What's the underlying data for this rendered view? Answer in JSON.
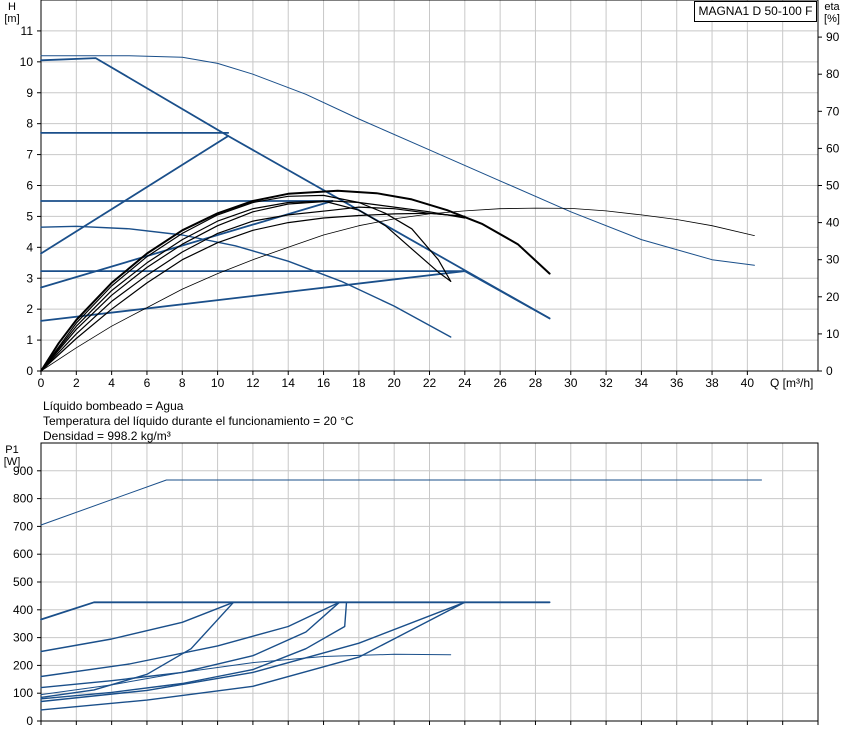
{
  "title": "MAGNA1 D 50-100 F",
  "fluid_info": [
    "Líquido bombeado = Agua",
    "Temperatura del líquido durante el funcionamiento = 20 °C",
    "Densidad = 998.2 kg/m³"
  ],
  "colors": {
    "blue": "#1a4f8a",
    "black": "#000000",
    "grid": "#c8c8c8"
  },
  "chart_data": [
    {
      "type": "line",
      "name": "top",
      "ylabel": "H",
      "yunit": "[m]",
      "y2label": "eta",
      "y2unit": "[%]",
      "xlabel": "Q [m³/h]",
      "xlim": [
        0,
        44
      ],
      "ylim": [
        0,
        12
      ],
      "y2lim": [
        0,
        100
      ],
      "xticks": [
        "0",
        "2",
        "4",
        "6",
        "8",
        "10",
        "12",
        "14",
        "16",
        "18",
        "20",
        "22",
        "24",
        "26",
        "28",
        "30",
        "32",
        "34",
        "36",
        "38",
        "40"
      ],
      "yticks": [
        "0",
        "1",
        "2",
        "3",
        "4",
        "5",
        "6",
        "7",
        "8",
        "9",
        "10",
        "11"
      ],
      "y2ticks": [
        "0",
        "10",
        "20",
        "30",
        "40",
        "50",
        "60",
        "70",
        "80",
        "90"
      ],
      "grid": true,
      "series": [
        {
          "color": "blue",
          "width": 1.8,
          "points": [
            [
              0,
              10.05
            ],
            [
              3.1,
              10.12
            ],
            [
              10.6,
              7.6
            ],
            [
              28.8,
              1.7
            ]
          ]
        },
        {
          "color": "blue",
          "width": 1.8,
          "points": [
            [
              0,
              7.7
            ],
            [
              10.6,
              7.7
            ]
          ]
        },
        {
          "color": "blue",
          "width": 1.8,
          "points": [
            [
              0,
              3.8
            ],
            [
              10.6,
              7.6
            ]
          ]
        },
        {
          "color": "blue",
          "width": 1.8,
          "points": [
            [
              0,
              5.5
            ],
            [
              16.5,
              5.5
            ]
          ]
        },
        {
          "color": "blue",
          "width": 1.8,
          "points": [
            [
              0,
              2.7
            ],
            [
              16.5,
              5.5
            ]
          ]
        },
        {
          "color": "blue",
          "width": 1.8,
          "points": [
            [
              0,
              3.23
            ],
            [
              24,
              3.23
            ],
            [
              28.8,
              1.7
            ]
          ]
        },
        {
          "color": "blue",
          "width": 1.8,
          "points": [
            [
              0,
              1.62
            ],
            [
              24,
              3.23
            ]
          ]
        },
        {
          "color": "blue",
          "width": 1.4,
          "points": [
            [
              0,
              4.65
            ],
            [
              2,
              4.68
            ],
            [
              5,
              4.6
            ],
            [
              8,
              4.4
            ],
            [
              11,
              4.05
            ],
            [
              14,
              3.55
            ],
            [
              17,
              2.9
            ],
            [
              20,
              2.1
            ],
            [
              23.2,
              1.1
            ]
          ]
        },
        {
          "color": "blue",
          "width": 1.0,
          "points": [
            [
              0,
              10.2
            ],
            [
              5,
              10.2
            ],
            [
              8,
              10.15
            ],
            [
              10,
              9.95
            ],
            [
              12,
              9.6
            ],
            [
              15,
              8.95
            ],
            [
              18,
              8.15
            ],
            [
              22,
              7.15
            ],
            [
              26,
              6.15
            ],
            [
              30,
              5.15
            ],
            [
              34,
              4.25
            ],
            [
              38,
              3.6
            ],
            [
              40.4,
              3.42
            ]
          ]
        },
        {
          "color": "black",
          "width": 2.0,
          "points": [
            [
              0,
              0
            ],
            [
              1,
              0.9
            ],
            [
              2,
              1.65
            ],
            [
              4,
              2.85
            ],
            [
              6,
              3.8
            ],
            [
              8,
              4.55
            ],
            [
              10,
              5.1
            ],
            [
              12,
              5.5
            ],
            [
              14,
              5.73
            ],
            [
              16.8,
              5.83
            ],
            [
              19,
              5.75
            ],
            [
              21,
              5.55
            ],
            [
              23,
              5.2
            ],
            [
              25,
              4.75
            ],
            [
              27,
              4.1
            ],
            [
              28.8,
              3.15
            ]
          ]
        },
        {
          "color": "black",
          "width": 1.2,
          "points": [
            [
              0,
              0
            ],
            [
              2,
              1.55
            ],
            [
              4,
              2.75
            ],
            [
              6,
              3.7
            ],
            [
              8,
              4.45
            ],
            [
              10,
              5.05
            ],
            [
              12,
              5.45
            ],
            [
              14,
              5.65
            ],
            [
              16,
              5.68
            ],
            [
              18,
              5.45
            ],
            [
              19.5,
              5.1
            ],
            [
              21,
              4.6
            ],
            [
              22.5,
              3.6
            ],
            [
              23.2,
              2.9
            ]
          ]
        },
        {
          "color": "black",
          "width": 1.2,
          "points": [
            [
              0,
              0
            ],
            [
              2,
              1.45
            ],
            [
              4,
              2.6
            ],
            [
              6,
              3.5
            ],
            [
              8,
              4.25
            ],
            [
              10,
              4.85
            ],
            [
              12,
              5.25
            ],
            [
              14,
              5.45
            ],
            [
              16,
              5.5
            ],
            [
              18,
              5.2
            ],
            [
              19.5,
              4.7
            ],
            [
              21,
              3.95
            ],
            [
              22.5,
              3.2
            ],
            [
              23.2,
              2.9
            ]
          ]
        },
        {
          "color": "black",
          "width": 1.2,
          "points": [
            [
              0,
              0
            ],
            [
              2,
              1.35
            ],
            [
              4,
              2.45
            ],
            [
              6,
              3.35
            ],
            [
              8,
              4.1
            ],
            [
              10,
              4.7
            ],
            [
              12,
              5.15
            ],
            [
              14,
              5.4
            ],
            [
              16.5,
              5.5
            ],
            [
              18,
              5.45
            ],
            [
              20,
              5.3
            ],
            [
              22,
              5.15
            ],
            [
              24,
              4.95
            ]
          ]
        },
        {
          "color": "black",
          "width": 1.2,
          "points": [
            [
              0,
              0
            ],
            [
              2,
              1.2
            ],
            [
              4,
              2.25
            ],
            [
              6,
              3.1
            ],
            [
              8,
              3.85
            ],
            [
              10,
              4.45
            ],
            [
              12,
              4.85
            ],
            [
              14,
              5.05
            ],
            [
              16.5,
              5.2
            ],
            [
              18,
              5.3
            ],
            [
              20,
              5.25
            ],
            [
              22,
              5.1
            ],
            [
              24,
              5.0
            ]
          ]
        },
        {
          "color": "black",
          "width": 1.2,
          "points": [
            [
              0,
              0
            ],
            [
              2,
              1.05
            ],
            [
              4,
              2.0
            ],
            [
              6,
              2.85
            ],
            [
              8,
              3.6
            ],
            [
              10,
              4.15
            ],
            [
              12,
              4.55
            ],
            [
              14,
              4.8
            ],
            [
              16,
              4.95
            ],
            [
              18,
              5.03
            ],
            [
              20,
              5.08
            ],
            [
              22,
              5.1
            ],
            [
              24,
              5.0
            ]
          ]
        },
        {
          "color": "black",
          "width": 0.8,
          "points": [
            [
              0,
              0
            ],
            [
              2,
              0.75
            ],
            [
              4,
              1.45
            ],
            [
              6,
              2.05
            ],
            [
              8,
              2.65
            ],
            [
              10,
              3.15
            ],
            [
              12,
              3.6
            ],
            [
              14,
              4.0
            ],
            [
              16,
              4.4
            ],
            [
              18,
              4.7
            ],
            [
              20,
              4.92
            ],
            [
              22,
              5.08
            ],
            [
              24,
              5.18
            ],
            [
              26,
              5.25
            ],
            [
              28,
              5.27
            ],
            [
              30,
              5.26
            ],
            [
              32,
              5.18
            ],
            [
              34,
              5.05
            ],
            [
              36,
              4.9
            ],
            [
              38,
              4.7
            ],
            [
              40.4,
              4.38
            ]
          ]
        }
      ]
    },
    {
      "type": "line",
      "name": "bottom",
      "ylabel": "P1",
      "yunit": "[W]",
      "xlim": [
        0,
        44
      ],
      "ylim": [
        0,
        1000
      ],
      "yticks": [
        "0",
        "100",
        "200",
        "300",
        "400",
        "500",
        "600",
        "700",
        "800",
        "900"
      ],
      "grid": true,
      "series": [
        {
          "color": "blue",
          "width": 1.0,
          "points": [
            [
              0,
              705
            ],
            [
              7.1,
              867
            ],
            [
              40.8,
              867
            ]
          ]
        },
        {
          "color": "blue",
          "width": 1.8,
          "points": [
            [
              0,
              365
            ],
            [
              3,
              427
            ],
            [
              28.8,
              427
            ]
          ]
        },
        {
          "color": "blue",
          "width": 1.4,
          "points": [
            [
              0,
              250
            ],
            [
              4,
              295
            ],
            [
              8,
              355
            ],
            [
              10.9,
              427
            ]
          ]
        },
        {
          "color": "blue",
          "width": 1.4,
          "points": [
            [
              0,
              85
            ],
            [
              3,
              112
            ],
            [
              6,
              168
            ],
            [
              8.5,
              260
            ],
            [
              10.9,
              427
            ]
          ]
        },
        {
          "color": "blue",
          "width": 1.4,
          "points": [
            [
              0,
              160
            ],
            [
              5,
              205
            ],
            [
              10,
              270
            ],
            [
              14,
              340
            ],
            [
              16.9,
              427
            ]
          ]
        },
        {
          "color": "blue",
          "width": 1.4,
          "points": [
            [
              0,
              120
            ],
            [
              4,
              145
            ],
            [
              8,
              175
            ],
            [
              12,
              235
            ],
            [
              15,
              320
            ],
            [
              16.9,
              427
            ]
          ]
        },
        {
          "color": "blue",
          "width": 1.4,
          "points": [
            [
              0,
              80
            ],
            [
              4,
              103
            ],
            [
              8,
              135
            ],
            [
              12,
              185
            ],
            [
              15,
              260
            ],
            [
              17.2,
              340
            ],
            [
              17.3,
              427
            ]
          ]
        },
        {
          "color": "blue",
          "width": 1.4,
          "points": [
            [
              0,
              70
            ],
            [
              6,
              110
            ],
            [
              12,
              175
            ],
            [
              18,
              280
            ],
            [
              24,
              427
            ]
          ]
        },
        {
          "color": "blue",
          "width": 1.4,
          "points": [
            [
              0,
              40
            ],
            [
              6,
              75
            ],
            [
              12,
              125
            ],
            [
              18,
              230
            ],
            [
              24,
              427
            ]
          ]
        },
        {
          "color": "blue",
          "width": 1.0,
          "points": [
            [
              0,
              95
            ],
            [
              4,
              130
            ],
            [
              8,
              175
            ],
            [
              12,
              210
            ],
            [
              16,
              232
            ],
            [
              20,
              240
            ],
            [
              23.2,
              238
            ]
          ]
        }
      ]
    }
  ]
}
